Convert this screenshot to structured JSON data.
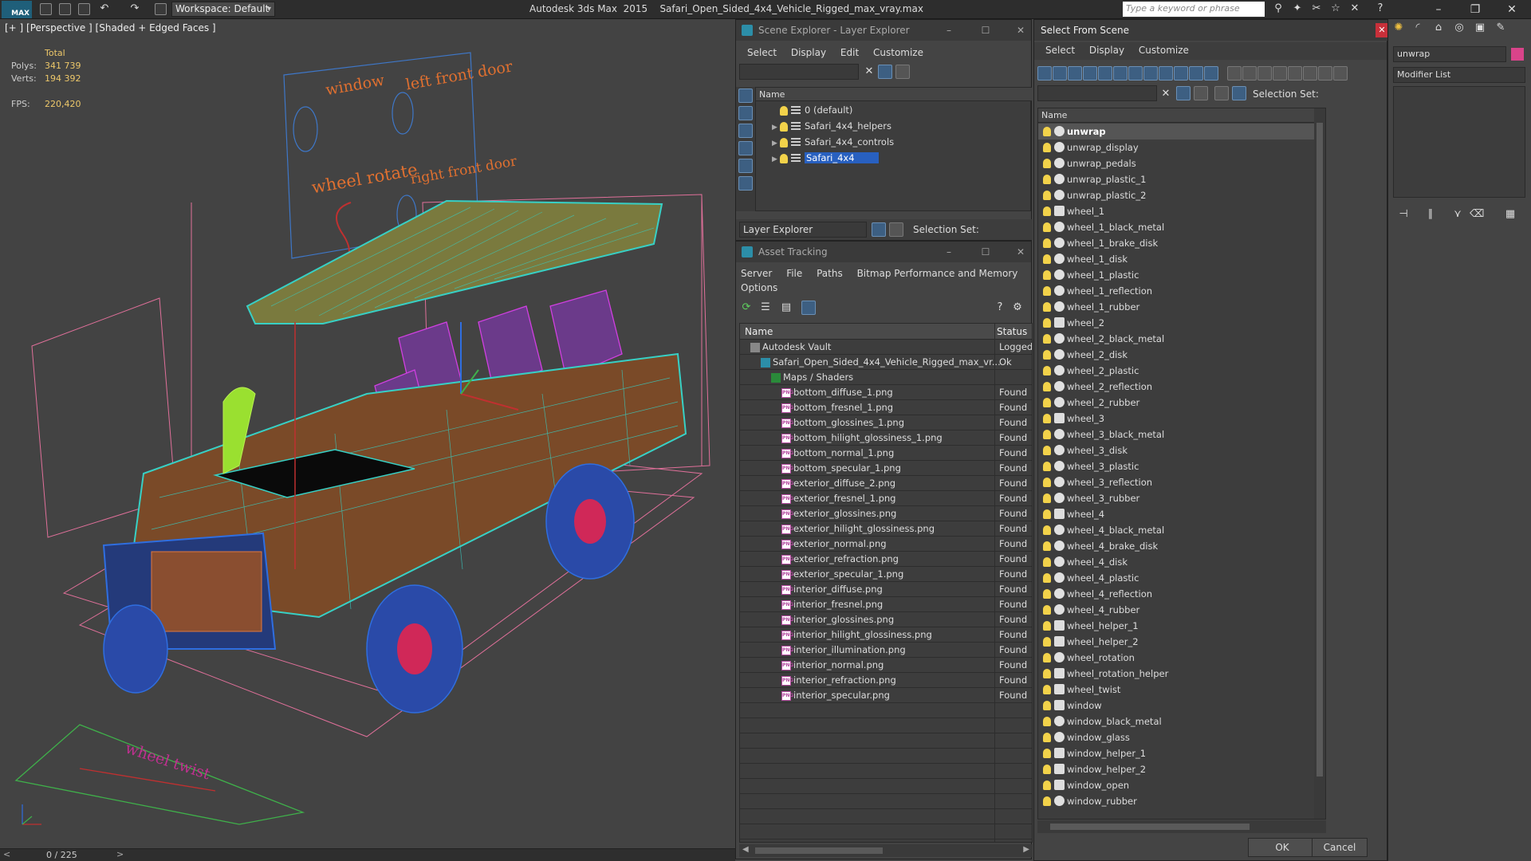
{
  "titlebar": {
    "logo": "MAX",
    "workspace": "Workspace: Default",
    "app_name": "Autodesk 3ds Max  2015",
    "file_name": "Safari_Open_Sided_4x4_Vehicle_Rigged_max_vray.max",
    "search_placeholder": "Type a keyword or phrase"
  },
  "viewport": {
    "label": "[+ ] [Perspective ] [Shaded + Edged Faces ]",
    "stats": {
      "header": "Total",
      "polys_label": "Polys:",
      "polys_value": "341 739",
      "verts_label": "Verts:",
      "verts_value": "194 392",
      "fps_label": "FPS:",
      "fps_value": "220,420"
    },
    "annotations": [
      "window",
      "left front door",
      "wheel rotate",
      "right front door",
      "wheel twist"
    ],
    "timeslider": "0 / 225",
    "time_prev": "<",
    "time_next": ">"
  },
  "scene_explorer": {
    "title": "Scene Explorer - Layer Explorer",
    "menu": [
      "Select",
      "Display",
      "Edit",
      "Customize"
    ],
    "column": "Name",
    "layers": [
      {
        "name": "0 (default)",
        "expandable": false,
        "selected": false
      },
      {
        "name": "Safari_4x4_helpers",
        "expandable": true,
        "selected": false
      },
      {
        "name": "Safari_4x4_controls",
        "expandable": true,
        "selected": false
      },
      {
        "name": "Safari_4x4",
        "expandable": true,
        "selected": true
      }
    ],
    "footer_dropdown": "Layer Explorer",
    "selection_set_label": "Selection Set:"
  },
  "asset_tracking": {
    "title": "Asset Tracking",
    "menu": [
      "Server",
      "File",
      "Paths",
      "Bitmap Performance and Memory"
    ],
    "menu2": [
      "Options"
    ],
    "col_name": "Name",
    "col_status": "Status",
    "rows": [
      {
        "name": "Autodesk Vault",
        "status": "Logged",
        "indent": 1,
        "kind": "vault"
      },
      {
        "name": "Safari_Open_Sided_4x4_Vehicle_Rigged_max_vr...",
        "status": "Ok",
        "indent": 2,
        "kind": "max"
      },
      {
        "name": "Maps / Shaders",
        "status": "",
        "indent": 3,
        "kind": "folder"
      },
      {
        "name": "bottom_diffuse_1.png",
        "status": "Found",
        "indent": 4,
        "kind": "png"
      },
      {
        "name": "bottom_fresnel_1.png",
        "status": "Found",
        "indent": 4,
        "kind": "png"
      },
      {
        "name": "bottom_glossines_1.png",
        "status": "Found",
        "indent": 4,
        "kind": "png"
      },
      {
        "name": "bottom_hilight_glossiness_1.png",
        "status": "Found",
        "indent": 4,
        "kind": "png"
      },
      {
        "name": "bottom_normal_1.png",
        "status": "Found",
        "indent": 4,
        "kind": "png"
      },
      {
        "name": "bottom_specular_1.png",
        "status": "Found",
        "indent": 4,
        "kind": "png"
      },
      {
        "name": "exterior_diffuse_2.png",
        "status": "Found",
        "indent": 4,
        "kind": "png"
      },
      {
        "name": "exterior_fresnel_1.png",
        "status": "Found",
        "indent": 4,
        "kind": "png"
      },
      {
        "name": "exterior_glossines.png",
        "status": "Found",
        "indent": 4,
        "kind": "png"
      },
      {
        "name": "exterior_hilight_glossiness.png",
        "status": "Found",
        "indent": 4,
        "kind": "png"
      },
      {
        "name": "exterior_normal.png",
        "status": "Found",
        "indent": 4,
        "kind": "png"
      },
      {
        "name": "exterior_refraction.png",
        "status": "Found",
        "indent": 4,
        "kind": "png"
      },
      {
        "name": "exterior_specular_1.png",
        "status": "Found",
        "indent": 4,
        "kind": "png"
      },
      {
        "name": "interior_diffuse.png",
        "status": "Found",
        "indent": 4,
        "kind": "png"
      },
      {
        "name": "interior_fresnel.png",
        "status": "Found",
        "indent": 4,
        "kind": "png"
      },
      {
        "name": "interior_glossines.png",
        "status": "Found",
        "indent": 4,
        "kind": "png"
      },
      {
        "name": "interior_hilight_glossiness.png",
        "status": "Found",
        "indent": 4,
        "kind": "png"
      },
      {
        "name": "interior_illumination.png",
        "status": "Found",
        "indent": 4,
        "kind": "png"
      },
      {
        "name": "interior_normal.png",
        "status": "Found",
        "indent": 4,
        "kind": "png"
      },
      {
        "name": "interior_refraction.png",
        "status": "Found",
        "indent": 4,
        "kind": "png"
      },
      {
        "name": "interior_specular.png",
        "status": "Found",
        "indent": 4,
        "kind": "png"
      }
    ]
  },
  "select_from_scene": {
    "title": "Select From Scene",
    "menu": [
      "Select",
      "Display",
      "Customize"
    ],
    "selection_set_label": "Selection Set:",
    "column": "Name",
    "objects": [
      {
        "name": "unwrap",
        "type": "geometry"
      },
      {
        "name": "unwrap_display",
        "type": "geometry"
      },
      {
        "name": "unwrap_pedals",
        "type": "geometry"
      },
      {
        "name": "unwrap_plastic_1",
        "type": "geometry"
      },
      {
        "name": "unwrap_plastic_2",
        "type": "geometry"
      },
      {
        "name": "wheel_1",
        "type": "helper"
      },
      {
        "name": "wheel_1_black_metal",
        "type": "geometry"
      },
      {
        "name": "wheel_1_brake_disk",
        "type": "geometry"
      },
      {
        "name": "wheel_1_disk",
        "type": "geometry"
      },
      {
        "name": "wheel_1_plastic",
        "type": "geometry"
      },
      {
        "name": "wheel_1_reflection",
        "type": "geometry"
      },
      {
        "name": "wheel_1_rubber",
        "type": "geometry"
      },
      {
        "name": "wheel_2",
        "type": "helper"
      },
      {
        "name": "wheel_2_black_metal",
        "type": "geometry"
      },
      {
        "name": "wheel_2_disk",
        "type": "geometry"
      },
      {
        "name": "wheel_2_plastic",
        "type": "geometry"
      },
      {
        "name": "wheel_2_reflection",
        "type": "geometry"
      },
      {
        "name": "wheel_2_rubber",
        "type": "geometry"
      },
      {
        "name": "wheel_3",
        "type": "helper"
      },
      {
        "name": "wheel_3_black_metal",
        "type": "geometry"
      },
      {
        "name": "wheel_3_disk",
        "type": "geometry"
      },
      {
        "name": "wheel_3_plastic",
        "type": "geometry"
      },
      {
        "name": "wheel_3_reflection",
        "type": "geometry"
      },
      {
        "name": "wheel_3_rubber",
        "type": "geometry"
      },
      {
        "name": "wheel_4",
        "type": "helper"
      },
      {
        "name": "wheel_4_black_metal",
        "type": "geometry"
      },
      {
        "name": "wheel_4_brake_disk",
        "type": "geometry"
      },
      {
        "name": "wheel_4_disk",
        "type": "geometry"
      },
      {
        "name": "wheel_4_plastic",
        "type": "geometry"
      },
      {
        "name": "wheel_4_reflection",
        "type": "geometry"
      },
      {
        "name": "wheel_4_rubber",
        "type": "geometry"
      },
      {
        "name": "wheel_helper_1",
        "type": "helper"
      },
      {
        "name": "wheel_helper_2",
        "type": "helper"
      },
      {
        "name": "wheel_rotation",
        "type": "geometry"
      },
      {
        "name": "wheel_rotation_helper",
        "type": "helper"
      },
      {
        "name": "wheel_twist",
        "type": "helper"
      },
      {
        "name": "window",
        "type": "helper"
      },
      {
        "name": "window_black_metal",
        "type": "geometry"
      },
      {
        "name": "window_glass",
        "type": "geometry"
      },
      {
        "name": "window_helper_1",
        "type": "helper"
      },
      {
        "name": "window_helper_2",
        "type": "helper"
      },
      {
        "name": "window_open",
        "type": "helper"
      },
      {
        "name": "window_rubber",
        "type": "geometry"
      }
    ],
    "ok_label": "OK",
    "cancel_label": "Cancel"
  },
  "command_panel": {
    "object_name": "unwrap",
    "modifier_list": "Modifier List"
  }
}
